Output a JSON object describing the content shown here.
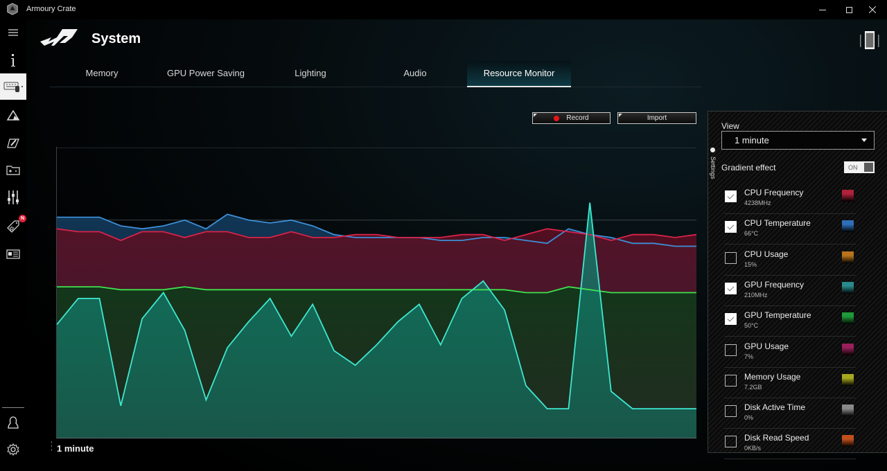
{
  "window": {
    "app_title": "Armoury Crate",
    "controls": {
      "minimize": "—",
      "maximize": "☐",
      "close": "✕"
    }
  },
  "sidebar": {
    "items": [
      {
        "name": "menu-icon",
        "glyph": "≡"
      },
      {
        "name": "info-icon",
        "glyph": "i"
      },
      {
        "name": "device-keyboard-icon",
        "glyph": "⌨",
        "active": true
      },
      {
        "name": "aura-icon",
        "glyph": "△"
      },
      {
        "name": "scenario-icon",
        "glyph": "✎"
      },
      {
        "name": "game-library-icon",
        "glyph": "▣"
      },
      {
        "name": "settings-sliders-icon",
        "glyph": "⫶"
      },
      {
        "name": "deals-tag-icon",
        "glyph": "◇",
        "badge": "N"
      },
      {
        "name": "news-icon",
        "glyph": "▤"
      },
      {
        "name": "user-center-icon",
        "glyph": "☺"
      },
      {
        "name": "settings-gear-icon",
        "glyph": "⚙"
      }
    ]
  },
  "header": {
    "title": "System"
  },
  "tabs": [
    {
      "label": "Memory",
      "active": false
    },
    {
      "label": "GPU Power Saving",
      "active": false
    },
    {
      "label": "Lighting",
      "active": false
    },
    {
      "label": "Audio",
      "active": false
    },
    {
      "label": "Resource Monitor",
      "active": true
    }
  ],
  "toolbar": {
    "record_label": "Record",
    "import_label": "Import"
  },
  "chart_footer": {
    "time_window": "1 minute"
  },
  "settings": {
    "tab_label": "Settings",
    "view_label": "View",
    "view_value": "1 minute",
    "gradient_label": "Gradient effect",
    "gradient_toggle": "ON",
    "metrics": [
      {
        "name": "CPU Frequency",
        "value": "4238MHz",
        "checked": true,
        "color": "#b0213a"
      },
      {
        "name": "CPU Temperature",
        "value": "66°C",
        "checked": true,
        "color": "#2f6fb8"
      },
      {
        "name": "CPU Usage",
        "value": "15%",
        "checked": false,
        "color": "#b8741c"
      },
      {
        "name": "GPU Frequency",
        "value": "210MHz",
        "checked": true,
        "color": "#2a8a8c"
      },
      {
        "name": "GPU Temperature",
        "value": "50°C",
        "checked": true,
        "color": "#1f9a3a"
      },
      {
        "name": "GPU Usage",
        "value": "7%",
        "checked": false,
        "color": "#9a1f5a"
      },
      {
        "name": "Memory Usage",
        "value": "7.2GB",
        "checked": false,
        "color": "#a8a820"
      },
      {
        "name": "Disk Active Time",
        "value": "0%",
        "checked": false,
        "color": "#8a8a8a"
      },
      {
        "name": "Disk Read Speed",
        "value": "0KB/s",
        "checked": false,
        "color": "#c0501c"
      }
    ]
  },
  "chart_data": {
    "type": "area",
    "title": "",
    "xlabel": "1 minute",
    "ylabel": "",
    "ylim": [
      0,
      100
    ],
    "grid": true,
    "gridlines": [
      25,
      50,
      75,
      100
    ],
    "x": [
      0,
      1,
      2,
      3,
      4,
      5,
      6,
      7,
      8,
      9,
      10,
      11,
      12,
      13,
      14,
      15,
      16,
      17,
      18,
      19,
      20,
      21,
      22,
      23,
      24,
      25,
      26,
      27,
      28,
      29,
      30
    ],
    "series": [
      {
        "name": "CPU Temperature",
        "color": "#3d8fd8",
        "fill": "#123a5c",
        "values": [
          76,
          76,
          76,
          73,
          72,
          73,
          75,
          72,
          77,
          75,
          74,
          75,
          73,
          70,
          69,
          69,
          69,
          69,
          68,
          68,
          69,
          69,
          68,
          67,
          72,
          70,
          69,
          67,
          67,
          66,
          66
        ]
      },
      {
        "name": "CPU Frequency",
        "color": "#d8234a",
        "fill": "#5a0f22",
        "values": [
          72,
          71,
          71,
          68,
          71,
          71,
          69,
          71,
          71,
          69,
          69,
          71,
          69,
          69,
          70,
          70,
          69,
          69,
          69,
          70,
          70,
          68,
          70,
          72,
          71,
          70,
          68,
          70,
          70,
          69,
          70
        ]
      },
      {
        "name": "GPU Temperature",
        "color": "#3ee24e",
        "fill": "#0d3a18",
        "values": [
          52,
          52,
          52,
          51,
          51,
          51,
          52,
          51,
          51,
          51,
          51,
          51,
          51,
          51,
          51,
          51,
          51,
          51,
          51,
          51,
          51,
          51,
          50,
          50,
          52,
          51,
          50,
          50,
          50,
          50,
          50
        ]
      },
      {
        "name": "GPU Frequency",
        "color": "#3ee8d0",
        "fill": "#127a6a",
        "values": [
          39,
          48,
          48,
          11,
          41,
          50,
          37,
          13,
          31,
          40,
          48,
          35,
          46,
          30,
          25,
          32,
          40,
          46,
          32,
          48,
          54,
          44,
          18,
          10,
          10,
          81,
          16,
          10,
          10,
          10,
          10
        ]
      }
    ]
  }
}
